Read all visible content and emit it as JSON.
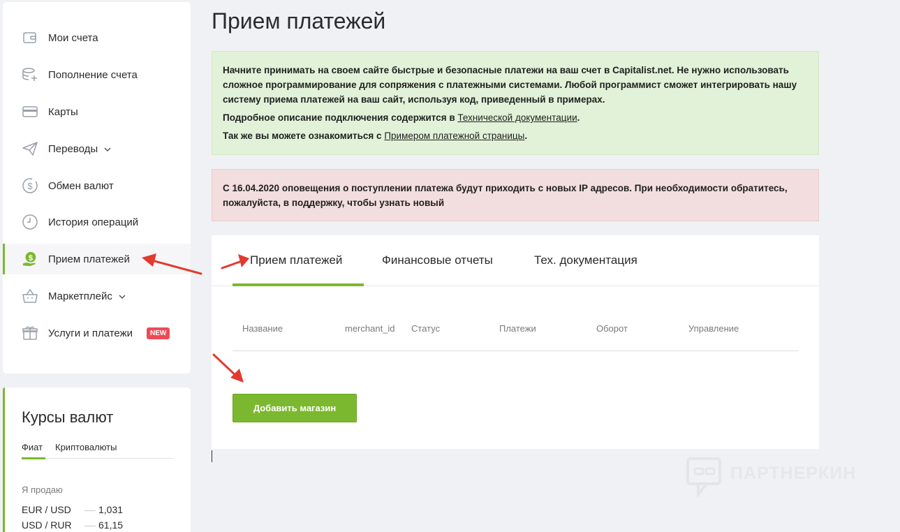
{
  "sidebar": {
    "items": [
      {
        "label": "Мои счета",
        "icon": "wallet-icon"
      },
      {
        "label": "Пополнение счета",
        "icon": "coins-plus-icon"
      },
      {
        "label": "Карты",
        "icon": "card-icon"
      },
      {
        "label": "Переводы",
        "icon": "paper-plane-icon"
      },
      {
        "label": "Обмен валют",
        "icon": "dollar-circle-icon"
      },
      {
        "label": "История операций",
        "icon": "clock-icon"
      },
      {
        "label": "Прием платежей",
        "icon": "payment-hand-icon"
      },
      {
        "label": "Маркетплейс",
        "icon": "basket-icon"
      },
      {
        "label": "Услуги и платежи",
        "icon": "gift-icon"
      }
    ],
    "new_badge": "NEW",
    "active_index": 6
  },
  "rates": {
    "title": "Курсы валют",
    "tabs": [
      "Фиат",
      "Криптовалюты"
    ],
    "sell_label": "Я продаю",
    "rows": [
      {
        "pair": "EUR / USD",
        "value": "1,031"
      },
      {
        "pair": "USD / RUR",
        "value": "61,15"
      }
    ]
  },
  "main": {
    "title": "Прием платежей",
    "info_green": {
      "paragraph1": "Начните принимать на своем сайте быстрые и безопасные платежи на ваш счет в Capitalist.net. Не нужно использовать сложное программирование для сопряжения с платежными системами. Любой программист сможет интегрировать нашу систему приема платежей на ваш сайт, используя код, приведенный в примерах.",
      "p2_prefix": "Подробное описание подключения содержится в ",
      "p2_link": "Технической документации",
      "p2_suffix": ".",
      "p3_prefix": "Так же вы можете ознакомиться с ",
      "p3_link": "Примером платежной страницы",
      "p3_suffix": "."
    },
    "info_red": "С 16.04.2020 оповещения о поступлении платежа будут приходить с новых IP адресов. При необходимости обратитесь, пожалуйста, в поддержку, чтобы узнать новый",
    "tabs": [
      "Прием платежей",
      "Финансовые отчеты",
      "Тех. документация"
    ],
    "table_headers": [
      "Название",
      "merchant_id",
      "Статус",
      "Платежи",
      "Оборот",
      "Управление"
    ],
    "add_button": "Добавить магазин"
  },
  "watermark": "ПАРТНЕРКИН",
  "colors": {
    "accent": "#7cb82f",
    "background": "#f0f1f4",
    "info_green_bg": "#e1f2d8",
    "info_red_bg": "#f2dede",
    "badge": "#ec4b56",
    "arrow": "#e33a2f"
  }
}
